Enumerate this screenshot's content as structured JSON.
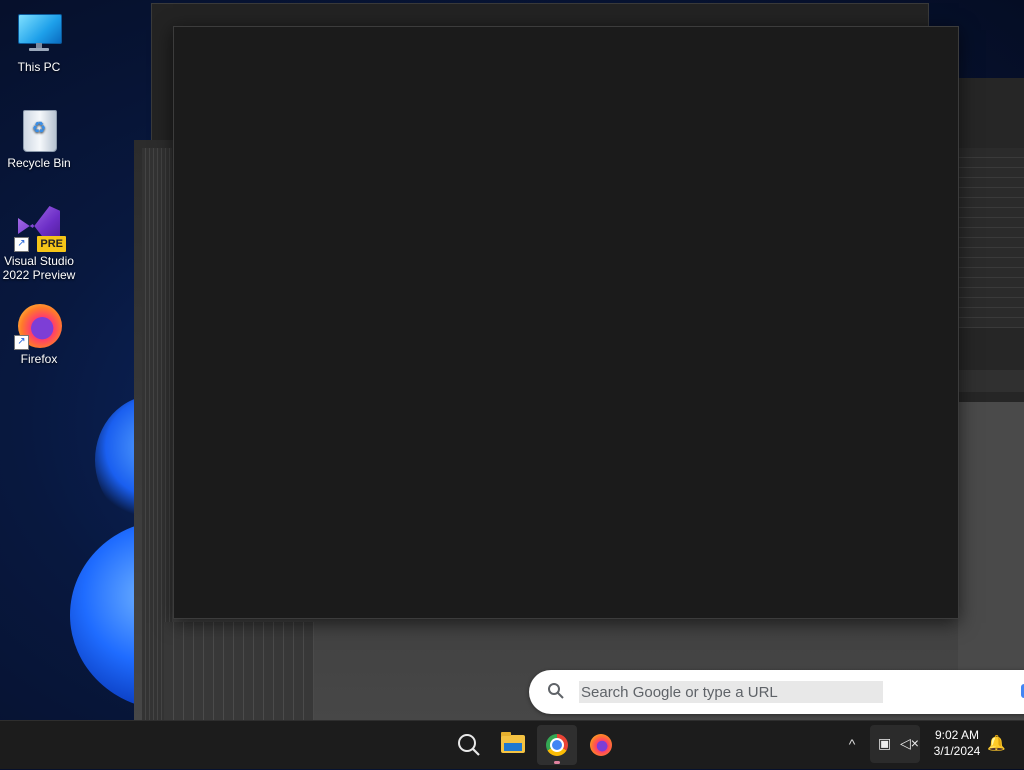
{
  "desktop": {
    "icons": [
      {
        "label": "This PC",
        "icon": "monitor-icon"
      },
      {
        "label": "Recycle Bin",
        "icon": "recycle-bin-icon"
      },
      {
        "label": "Visual Studio 2022 Preview",
        "line1": "Visual Studio",
        "line2": "2022 Preview",
        "badge": "PRE",
        "icon": "visual-studio-icon"
      },
      {
        "label": "Firefox",
        "icon": "firefox-icon"
      }
    ]
  },
  "browser": {
    "search_placeholder": "Search Google or type a URL"
  },
  "taskbar": {
    "apps": [
      {
        "name": "search",
        "icon": "search-icon"
      },
      {
        "name": "file-explorer",
        "icon": "folder-icon"
      },
      {
        "name": "chrome",
        "icon": "chrome-icon",
        "active": true
      },
      {
        "name": "firefox",
        "icon": "firefox-icon"
      }
    ],
    "tray": {
      "overflow": "^",
      "time": "9:02 AM",
      "date": "3/1/2024"
    }
  },
  "colors": {
    "taskbar_bg": "#1c1c1c",
    "window_bg": "#1b1b1b",
    "accent": "#4285f4"
  }
}
